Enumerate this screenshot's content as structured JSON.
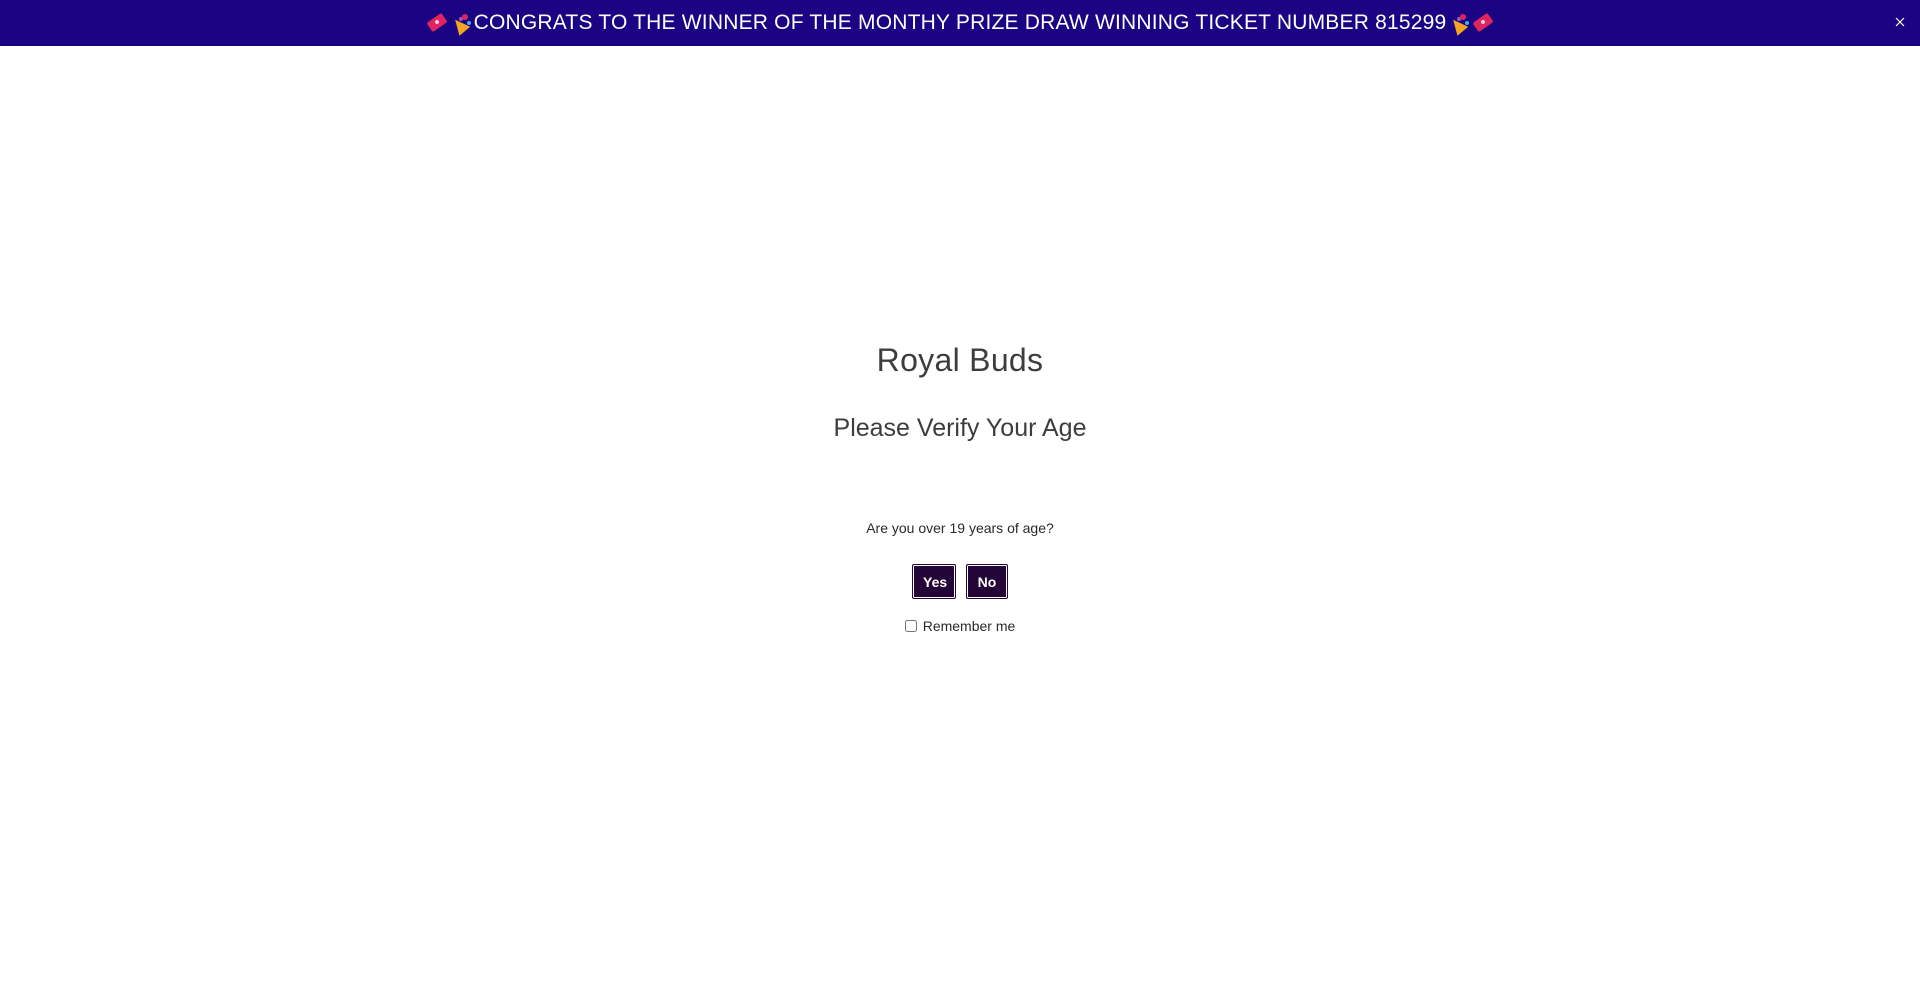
{
  "announcement": {
    "text": "CONGRATS TO THE WINNER OF THE MONTHY PRIZE DRAW WINNING TICKET NUMBER 815299",
    "background_color": "#1a0483",
    "text_color": "#ffffff",
    "leading_icons": [
      "ticket-icon",
      "party-popper-icon"
    ],
    "trailing_icons": [
      "party-popper-icon",
      "ticket-icon"
    ],
    "close_icon": "close-icon"
  },
  "age_gate": {
    "brand": "Royal Buds",
    "heading": "Please Verify Your Age",
    "question": "Are you over 19 years of age?",
    "yes_label": "Yes",
    "no_label": "No",
    "remember_label": "Remember me",
    "remember_checked": false,
    "button_color": "#240537"
  }
}
